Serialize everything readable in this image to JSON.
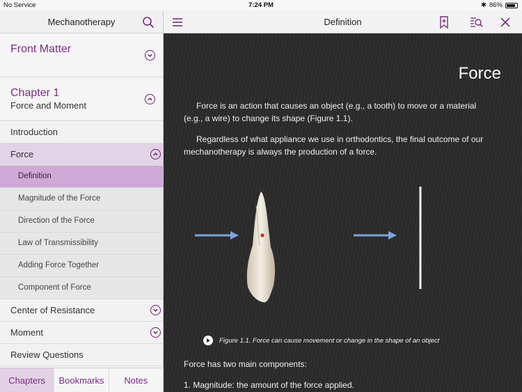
{
  "status": {
    "carrier": "No Service",
    "time": "7:24 PM",
    "battery": "86%"
  },
  "sidebar": {
    "title": "Mechanotherapy",
    "front_matter": "Front Matter",
    "chapter_title": "Chapter 1",
    "chapter_subtitle": "Force and Moment",
    "items": [
      {
        "label": "Introduction"
      },
      {
        "label": "Force"
      },
      {
        "label": "Center of Resistance"
      },
      {
        "label": "Moment"
      },
      {
        "label": "Review Questions"
      }
    ],
    "subitems": [
      {
        "label": "Definition"
      },
      {
        "label": "Magnitude of the Force"
      },
      {
        "label": "Direction of the Force"
      },
      {
        "label": "Law of Transmissibility"
      },
      {
        "label": "Adding Force Together"
      },
      {
        "label": "Component of Force"
      }
    ],
    "tabs": [
      {
        "label": "Chapters"
      },
      {
        "label": "Bookmarks"
      },
      {
        "label": "Notes"
      }
    ]
  },
  "main": {
    "title": "Definition",
    "heading": "Force",
    "paragraphs": [
      "Force is an action that causes an object (e.g., a tooth) to move or a material (e.g., a wire) to change its shape (Figure 1.1).",
      "Regardless of what appliance we use in orthodontics, the final outcome of our mechanotherapy is always the production of a force."
    ],
    "caption": "Figure 1.1. Force can cause movement or change in the shape of an object",
    "components_intro": "Force has two main components:",
    "component_1": "1. Magnitude: the amount of the force applied."
  },
  "colors": {
    "accent": "#7b2d83",
    "active_sub": "#cfa9d6",
    "arrow": "#7aa5e0",
    "content_bg": "#2b2b2b"
  }
}
